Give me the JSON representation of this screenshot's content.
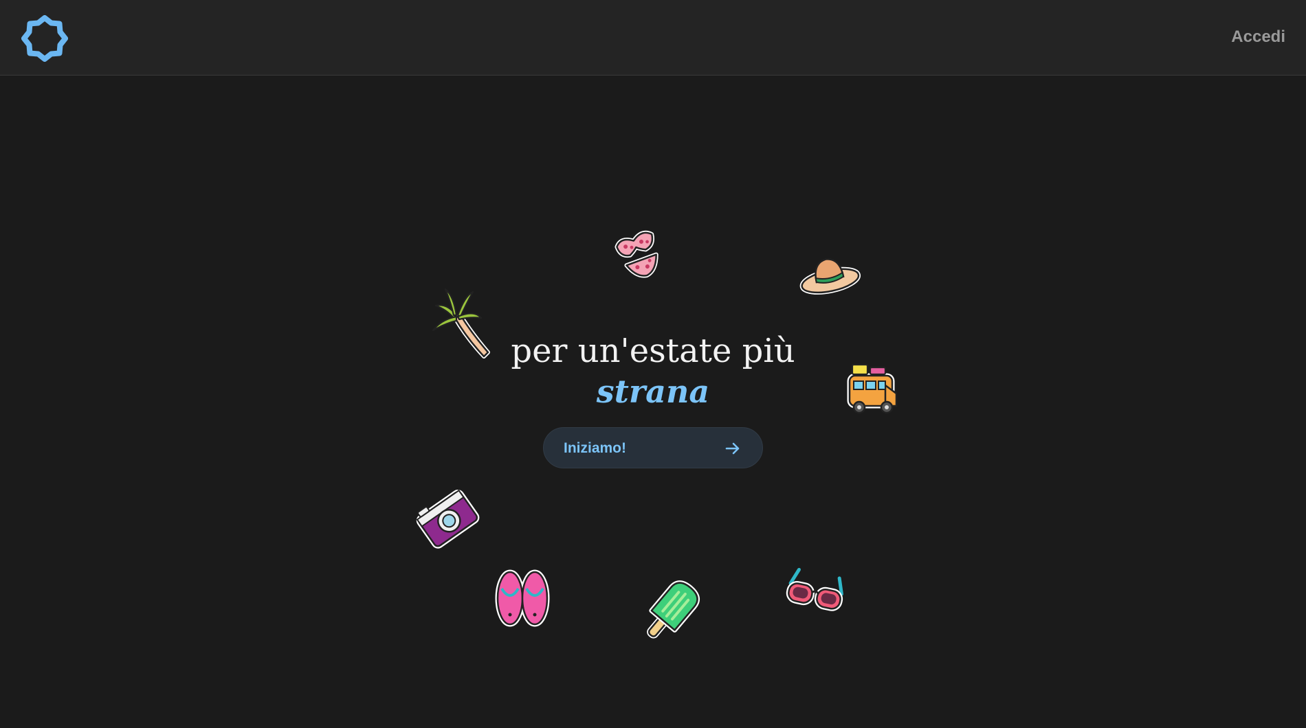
{
  "header": {
    "logo_icon": "eight-point-star-outline-icon",
    "login_label": "Accedi"
  },
  "hero": {
    "headline_line1": "per un'estate più",
    "headline_accent": "strana",
    "cta_label": "Iniziamo!",
    "cta_icon": "arrow-right-icon"
  },
  "stickers": [
    "bikini-icon",
    "sun-hat-icon",
    "palm-tree-icon",
    "camper-van-icon",
    "camera-icon",
    "flip-flops-icon",
    "popsicle-icon",
    "sunglasses-icon"
  ],
  "colors": {
    "background": "#1b1b1b",
    "header_background": "#242424",
    "accent": "#7cc4f8",
    "button_background": "#27303a",
    "login_text": "#9a9a9a"
  }
}
